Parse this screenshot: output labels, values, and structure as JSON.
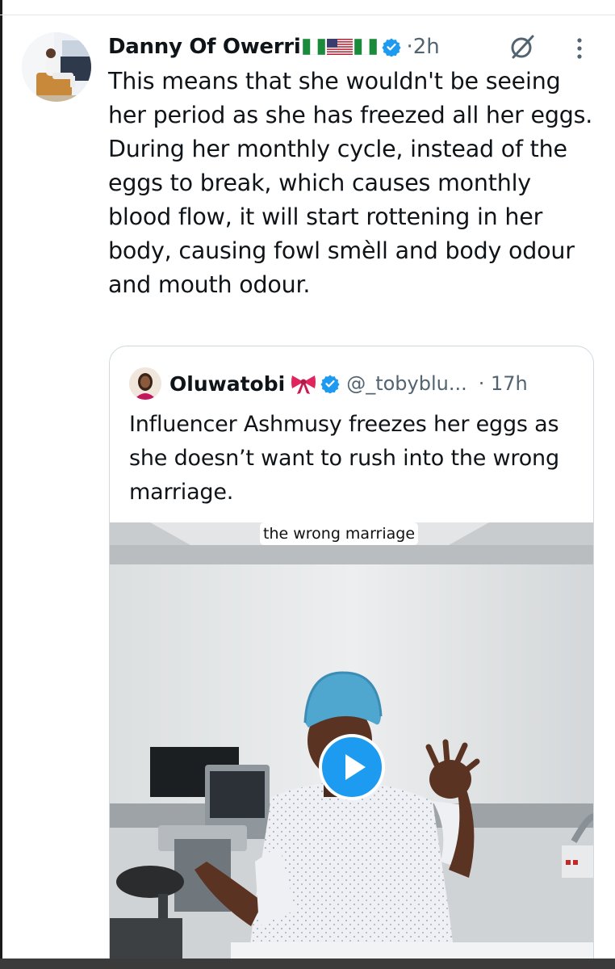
{
  "tweet": {
    "author": "Danny Of Owerri",
    "time_sep": "·",
    "time": "2h",
    "text": "This means that she wouldn't be seeing her period as she has freezed all her eggs.\nDuring her monthly cycle, instead of the eggs to break, which causes monthly blood flow, it will start rottening in her body, causing fowl smèll and body odour and mouth odour."
  },
  "icons": {
    "grok": "grok-icon",
    "more": "more-icon",
    "verified": "verified-badge-icon",
    "bow": "ribbon-bow-emoji",
    "play": "play-icon",
    "flags": [
      "nigeria-flag",
      "usa-flag",
      "nigeria-flag"
    ]
  },
  "quote": {
    "author": "Oluwatobi",
    "handle": "@_tobyblu...",
    "time": "· 17h",
    "text": "Influencer Ashmusy freezes her eggs as she doesn’t want to rush into the wrong marriage.",
    "video_caption": "the wrong marriage"
  },
  "colors": {
    "accent": "#1d9bf0",
    "text": "#0f1419",
    "muted": "#536471",
    "border": "#cfd9de"
  }
}
